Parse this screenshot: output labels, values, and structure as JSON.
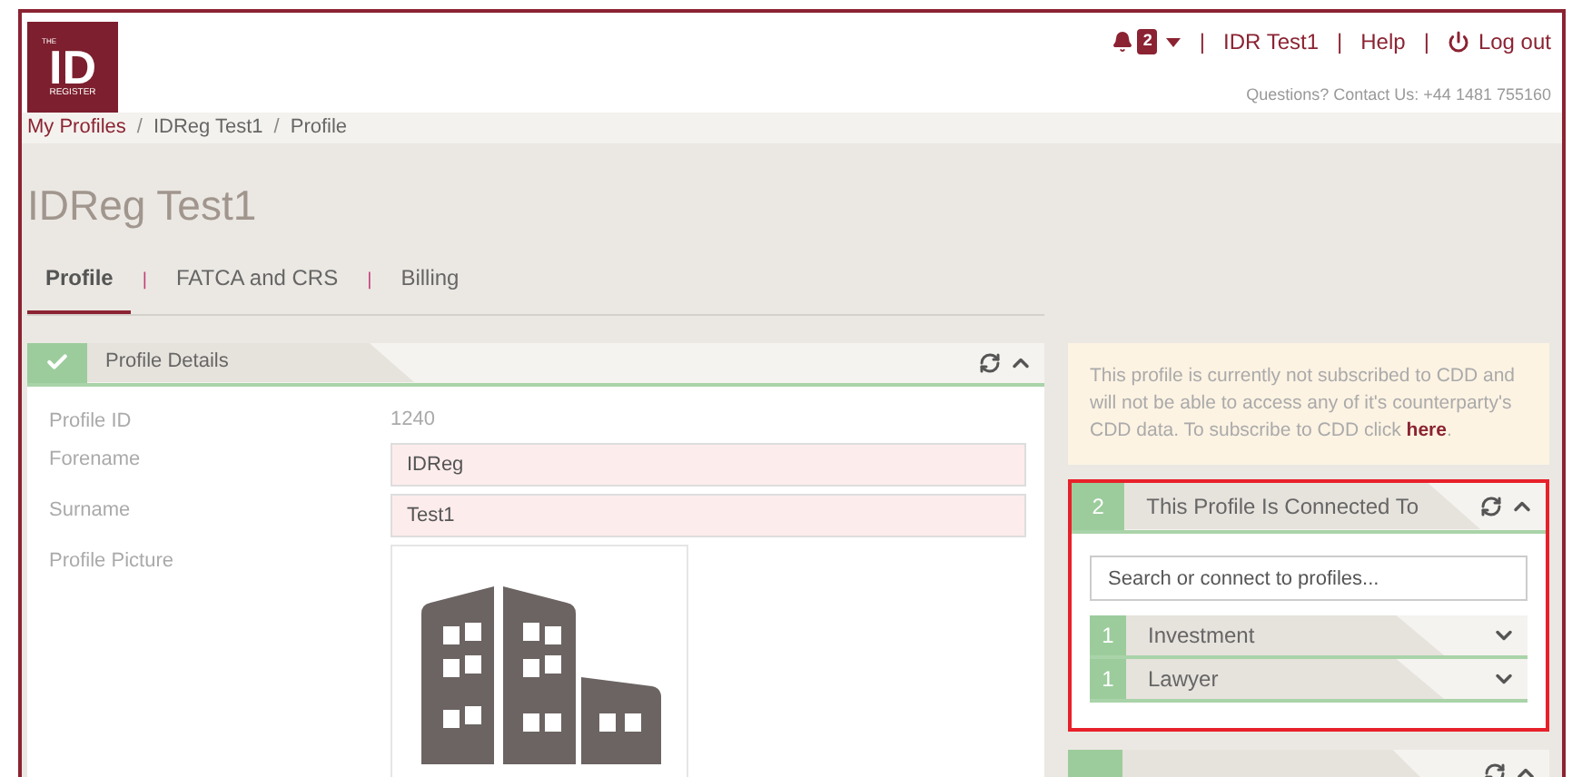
{
  "logo": {
    "top": "THE",
    "main": "ID",
    "bottom": "REGISTER"
  },
  "top_nav": {
    "notifications": "2",
    "user": "IDR Test1",
    "help": "Help",
    "logout": "Log out",
    "separator": "|",
    "contact": "Questions? Contact Us: +44 1481 755160"
  },
  "breadcrumbs": [
    {
      "label": "My Profiles",
      "link": true
    },
    {
      "label": "IDReg Test1",
      "link": false
    },
    {
      "label": "Profile",
      "link": false
    }
  ],
  "breadcrumb_separator": "/",
  "page_title": "IDReg Test1",
  "tabs": [
    {
      "label": "Profile",
      "selected": true
    },
    {
      "label": "FATCA and CRS",
      "selected": false
    },
    {
      "label": "Billing",
      "selected": false
    }
  ],
  "tab_separator": "|",
  "profile_details": {
    "title": "Profile Details",
    "complete": true,
    "fields": [
      {
        "kind": "text",
        "label": "Profile ID",
        "value": "1240"
      },
      {
        "kind": "input",
        "label": "Forename",
        "value": "IDReg"
      },
      {
        "kind": "input",
        "label": "Surname",
        "value": "Test1"
      },
      {
        "kind": "picture",
        "label": "Profile Picture"
      }
    ]
  },
  "cdd_notice": {
    "text": "This profile is currently not subscribed to CDD and will not be able to access any of it's counterparty's CDD data. To subscribe to CDD click ",
    "link": "here",
    "end": "."
  },
  "connected_panel": {
    "count": "2",
    "title": "This Profile Is Connected To",
    "expanded": true,
    "highlighted": true,
    "search": {
      "placeholder": "Search or connect to profiles..."
    },
    "groups": [
      {
        "count": "1",
        "label": "Investment",
        "expanded": false
      },
      {
        "count": "1",
        "label": "Lawyer",
        "expanded": false
      }
    ]
  },
  "users_panel": {
    "expanded": true
  }
}
